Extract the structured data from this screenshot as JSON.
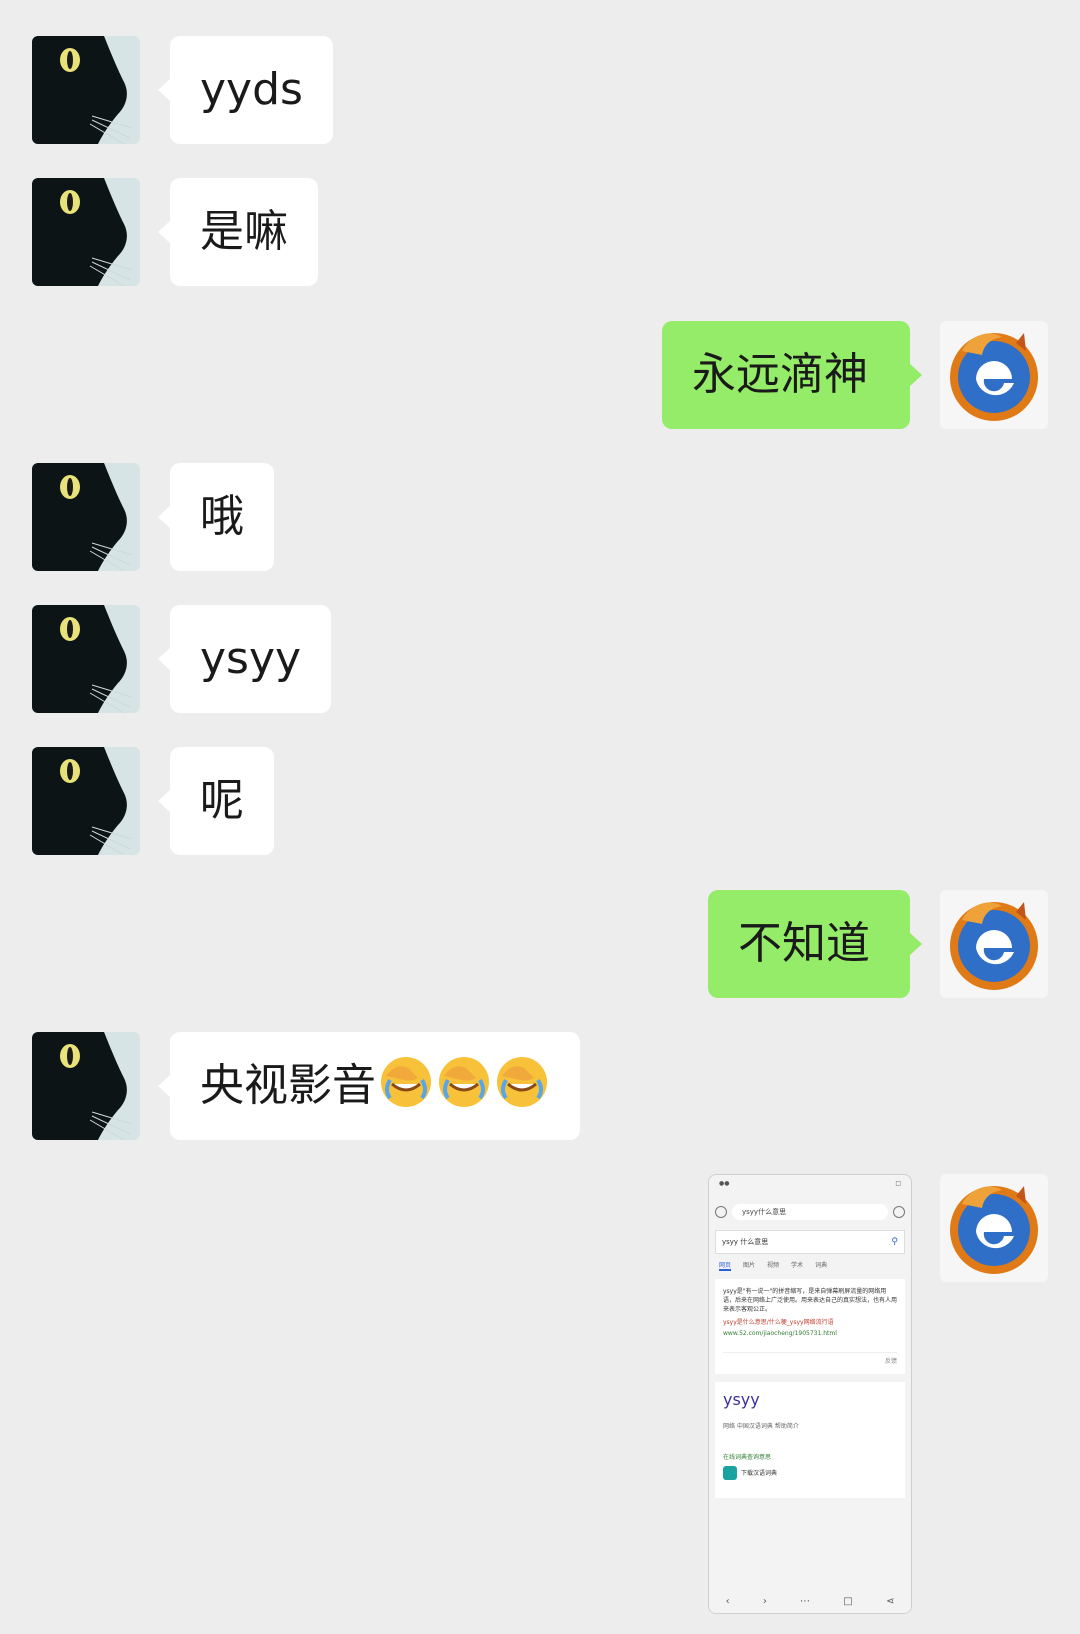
{
  "messages": [
    {
      "side": "in",
      "text": "yyds"
    },
    {
      "side": "in",
      "text": "是嘛"
    },
    {
      "side": "out",
      "text": "永远滴神"
    },
    {
      "side": "in",
      "text": "哦"
    },
    {
      "side": "in",
      "text": "ysyy"
    },
    {
      "side": "in",
      "text": "呢"
    },
    {
      "side": "out",
      "text": "不知道"
    },
    {
      "side": "in",
      "text": "央视影音",
      "emoji": [
        "facepalm-crying-emoji",
        "facepalm-crying-emoji",
        "facepalm-crying-emoji"
      ]
    },
    {
      "side": "out",
      "type": "image"
    }
  ],
  "colors": {
    "background": "#ededed",
    "incoming_bubble": "#ffffff",
    "outgoing_bubble": "#95ec69"
  },
  "avatars": {
    "incoming": "black-cat-avatar",
    "outgoing": "firefox-ie-logo-avatar"
  },
  "screenshot": {
    "url_text": "ysyy什么意思",
    "search_text": "ysyy 什么意思",
    "tabs": [
      "网页",
      "图片",
      "视频",
      "学术",
      "词典"
    ],
    "result_text": "ysyy是\"有一说一\"的拼音缩写，是来自弹幕刷屏流量的网络用语，后来在网络上广泛使用。用来表达自己的真实想法，也有人用来表示客观公正。",
    "result_link": "ysyy是什么意思/什么梗_ysyy网络流行语",
    "result_url": "www.52.com/jiaocheng/1905731.html",
    "more": "反馈",
    "dict_word": "ysyy",
    "dict_meta": "网络  中国汉语词典  帮助简介",
    "dict_green": "在线词典查询意思",
    "dict_download": "下载汉语词典"
  }
}
